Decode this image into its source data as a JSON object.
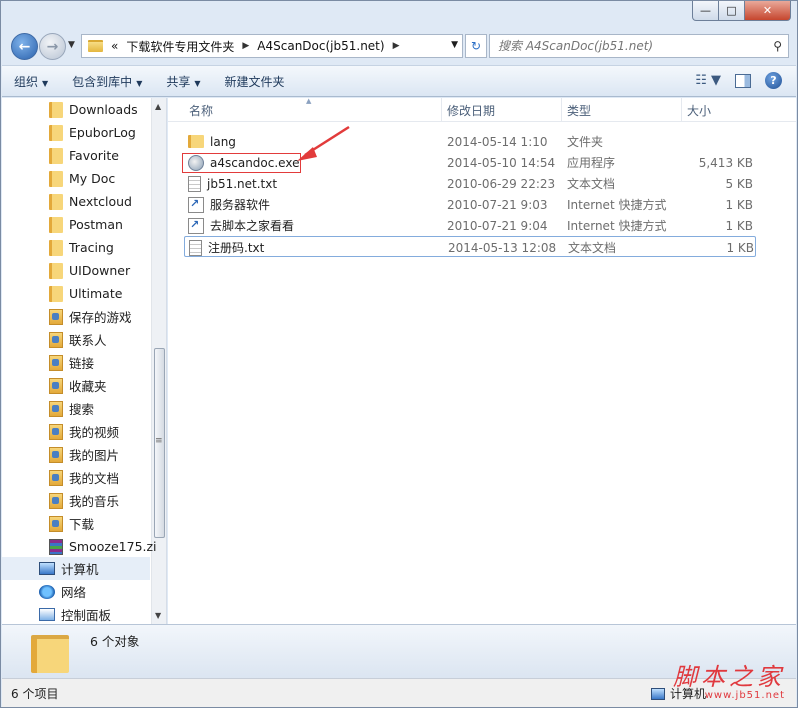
{
  "window_controls": {
    "minimize": "—",
    "maximize": "□",
    "close": "✕"
  },
  "address": {
    "prefix": "«",
    "crumbs": [
      "下载软件专用文件夹",
      "A4ScanDoc(jb51.net)"
    ],
    "refresh": "↻",
    "search_placeholder": "搜索 A4ScanDoc(jb51.net)"
  },
  "toolbar": {
    "organize": "组织",
    "include_in_library": "包含到库中",
    "share": "共享",
    "new_folder": "新建文件夹"
  },
  "nav": {
    "items": [
      {
        "label": "Downloads",
        "icon": "folder-icon"
      },
      {
        "label": "EpuborLog",
        "icon": "folder-icon"
      },
      {
        "label": "Favorite",
        "icon": "folder-icon"
      },
      {
        "label": "My Doc",
        "icon": "folder-icon"
      },
      {
        "label": "Nextcloud",
        "icon": "folder-icon"
      },
      {
        "label": "Postman",
        "icon": "folder-icon"
      },
      {
        "label": "Tracing",
        "icon": "folder-icon"
      },
      {
        "label": "UIDowner",
        "icon": "folder-icon"
      },
      {
        "label": "Ultimate",
        "icon": "folder-icon"
      },
      {
        "label": "保存的游戏",
        "icon": "saved-games-icon"
      },
      {
        "label": "联系人",
        "icon": "contacts-icon"
      },
      {
        "label": "链接",
        "icon": "links-icon"
      },
      {
        "label": "收藏夹",
        "icon": "favorites-icon"
      },
      {
        "label": "搜索",
        "icon": "searches-icon"
      },
      {
        "label": "我的视频",
        "icon": "videos-icon"
      },
      {
        "label": "我的图片",
        "icon": "pictures-icon"
      },
      {
        "label": "我的文档",
        "icon": "documents-icon"
      },
      {
        "label": "我的音乐",
        "icon": "music-icon"
      },
      {
        "label": "下载",
        "icon": "download-icon"
      },
      {
        "label": "Smooze175.zi",
        "icon": "winrar-archive-icon"
      }
    ],
    "computer": "计算机",
    "network": "网络",
    "control_panel": "控制面板"
  },
  "columns": {
    "name": "名称",
    "modified": "修改日期",
    "type": "类型",
    "size": "大小"
  },
  "files": [
    {
      "name": "lang",
      "modified": "2014-05-14 1:10",
      "type": "文件夹",
      "size": "",
      "icon": "folder-icon"
    },
    {
      "name": "a4scandoc.exe",
      "modified": "2014-05-10 14:54",
      "type": "应用程序",
      "size": "5,413 KB",
      "icon": "exe-icon"
    },
    {
      "name": "jb51.net.txt",
      "modified": "2010-06-29 22:23",
      "type": "文本文档",
      "size": "5 KB",
      "icon": "text-file-icon"
    },
    {
      "name": "服务器软件",
      "modified": "2010-07-21 9:03",
      "type": "Internet 快捷方式",
      "size": "1 KB",
      "icon": "internet-shortcut-icon"
    },
    {
      "name": "去脚本之家看看",
      "modified": "2010-07-21 9:04",
      "type": "Internet 快捷方式",
      "size": "1 KB",
      "icon": "internet-shortcut-icon"
    },
    {
      "name": "注册码.txt",
      "modified": "2014-05-13 12:08",
      "type": "文本文档",
      "size": "1 KB",
      "icon": "text-file-icon"
    }
  ],
  "details": {
    "count": "6 个对象"
  },
  "status": {
    "items": "6 个项目",
    "location": "计算机"
  },
  "watermark": {
    "text": "脚本之家",
    "url": "www.jb51.net"
  },
  "colors": {
    "accent_border": "#e23b3b",
    "selection_border": "#84acdd",
    "arrow": "#e23b3b"
  }
}
